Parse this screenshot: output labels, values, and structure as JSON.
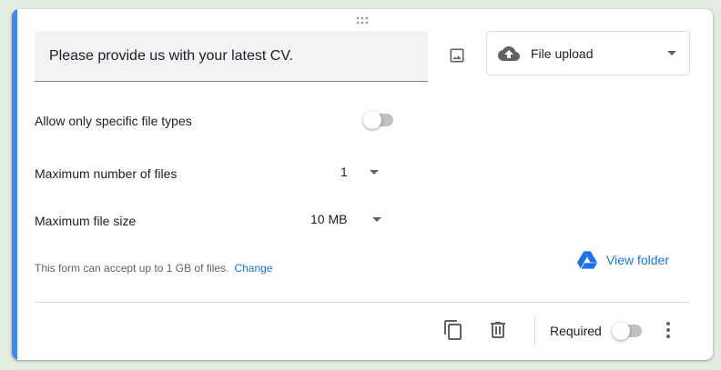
{
  "question": {
    "title": "Please provide us with your latest CV."
  },
  "question_type": {
    "selected": "File upload",
    "icon": "cloud-upload-icon"
  },
  "settings": {
    "allow_specific_types_label": "Allow only specific file types",
    "allow_specific_types_on": false,
    "max_files_label": "Maximum number of files",
    "max_files_value": "1",
    "max_size_label": "Maximum file size",
    "max_size_value": "10 MB"
  },
  "quota": {
    "note": "This form can accept up to 1 GB of files.",
    "change_link": "Change"
  },
  "drive": {
    "view_folder_label": "View folder"
  },
  "footer": {
    "required_label": "Required",
    "required_on": false
  },
  "colors": {
    "accent": "#4285f4",
    "link": "#1a73e8",
    "icon": "#5f6368",
    "background": "#e3eee0"
  }
}
